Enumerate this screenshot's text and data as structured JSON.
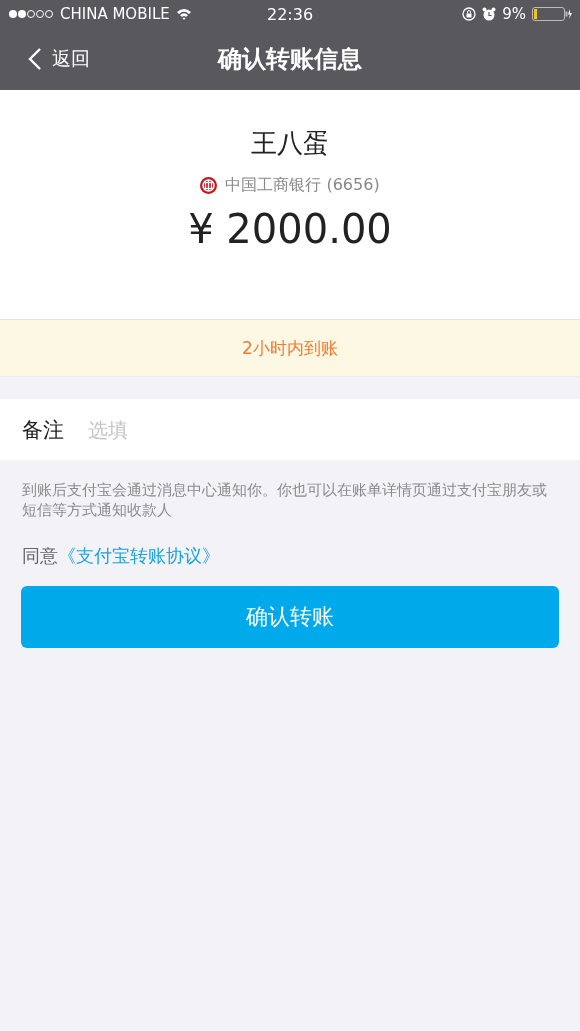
{
  "status_bar": {
    "carrier": "CHINA MOBILE",
    "time": "22:36",
    "battery": "9%"
  },
  "nav": {
    "back": "返回",
    "title": "确认转账信息"
  },
  "payee": {
    "name": "王八蛋",
    "bank": "中国工商银行 (6656)",
    "amount": "¥ 2000.00"
  },
  "notice": "2小时内到账",
  "remark": {
    "label": "备注",
    "placeholder": "选填"
  },
  "hint": "到账后支付宝会通过消息中心通知你。你也可以在账单详情页通过支付宝朋友或短信等方式通知收款人",
  "agreement": {
    "prefix": "同意",
    "link": "《支付宝转账协议》"
  },
  "confirm_button": "确认转账"
}
